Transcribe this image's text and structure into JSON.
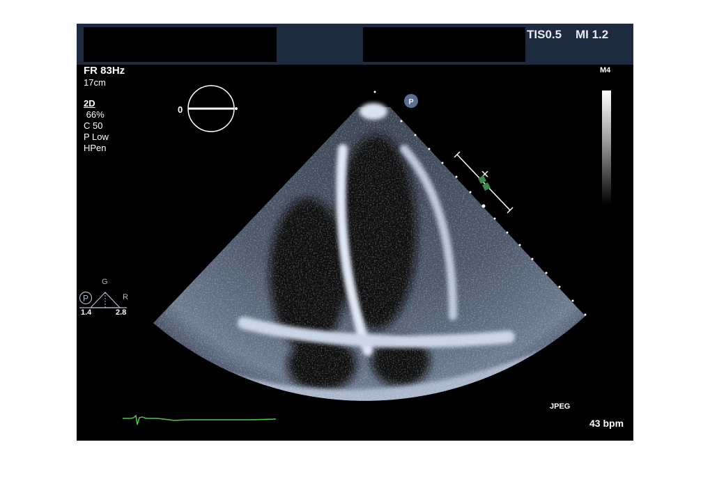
{
  "header": {
    "tis": "TIS0.5",
    "mi": "MI 1.2"
  },
  "probe": "M4",
  "params": {
    "frame_rate": "FR 83Hz",
    "depth": "17cm",
    "mode": "2D",
    "gain": " 66%",
    "compression": "C 50",
    "power": "P Low",
    "harmonics": "HPen"
  },
  "orientation": {
    "angle": "0"
  },
  "focus": {
    "p_marker": "P",
    "g_label": "G",
    "r_label": "R",
    "left_value": "1.4",
    "right_value": "2.8"
  },
  "footer": {
    "format": "JPEG",
    "heart_rate": "43 bpm"
  },
  "colors": {
    "header_bg": "#1e2a3e",
    "screen_bg": "#000000",
    "ecg": "#4cc94c",
    "tissue": "#c8d4e6"
  }
}
